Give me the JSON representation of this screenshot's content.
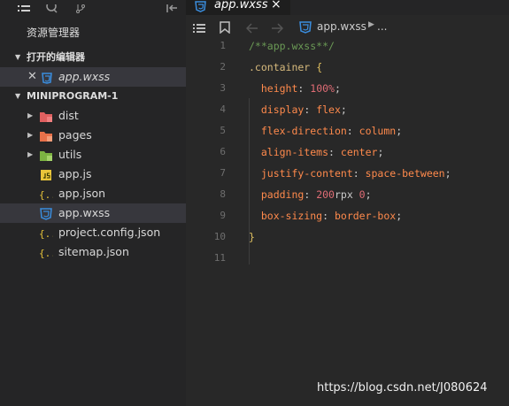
{
  "sidebar": {
    "title": "资源管理器",
    "open_editors": {
      "label": "打开的编辑器",
      "items": [
        {
          "label": "app.wxss"
        }
      ]
    },
    "project": {
      "label": "MINIPROGRAM-1",
      "items": [
        {
          "label": "dist",
          "type": "folder",
          "icon": "folder-red-icon"
        },
        {
          "label": "pages",
          "type": "folder",
          "icon": "folder-orange-icon"
        },
        {
          "label": "utils",
          "type": "folder",
          "icon": "folder-green-icon"
        },
        {
          "label": "app.js",
          "type": "file",
          "icon": "js-file-icon"
        },
        {
          "label": "app.json",
          "type": "file",
          "icon": "json-file-icon"
        },
        {
          "label": "app.wxss",
          "type": "file",
          "icon": "css-file-icon",
          "selected": true
        },
        {
          "label": "project.config.json",
          "type": "file",
          "icon": "json-file-icon"
        },
        {
          "label": "sitemap.json",
          "type": "file",
          "icon": "json-file-icon"
        }
      ]
    }
  },
  "editor": {
    "tab": {
      "label": "app.wxss",
      "close": "×"
    },
    "breadcrumb": {
      "file": "app.wxss",
      "more": "..."
    },
    "lines": [
      {
        "n": "1",
        "tokens": [
          [
            "comment",
            "/**app.wxss**/"
          ]
        ]
      },
      {
        "n": "2",
        "tokens": [
          [
            "sel",
            ".container"
          ],
          [
            "punc",
            " "
          ],
          [
            "brace",
            "{"
          ]
        ]
      },
      {
        "n": "3",
        "tokens": [
          [
            "punc",
            "  "
          ],
          [
            "prop",
            "height"
          ],
          [
            "punc",
            ": "
          ],
          [
            "num",
            "100%"
          ],
          [
            "punc",
            ";"
          ]
        ]
      },
      {
        "n": "4",
        "tokens": [
          [
            "punc",
            "  "
          ],
          [
            "prop",
            "display"
          ],
          [
            "punc",
            ": "
          ],
          [
            "val",
            "flex"
          ],
          [
            "punc",
            ";"
          ]
        ]
      },
      {
        "n": "5",
        "tokens": [
          [
            "punc",
            "  "
          ],
          [
            "prop",
            "flex-direction"
          ],
          [
            "punc",
            ": "
          ],
          [
            "val",
            "column"
          ],
          [
            "punc",
            ";"
          ]
        ]
      },
      {
        "n": "6",
        "tokens": [
          [
            "punc",
            "  "
          ],
          [
            "prop",
            "align-items"
          ],
          [
            "punc",
            ": "
          ],
          [
            "val",
            "center"
          ],
          [
            "punc",
            ";"
          ]
        ]
      },
      {
        "n": "7",
        "tokens": [
          [
            "punc",
            "  "
          ],
          [
            "prop",
            "justify-content"
          ],
          [
            "punc",
            ": "
          ],
          [
            "val",
            "space-between"
          ],
          [
            "punc",
            ";"
          ]
        ]
      },
      {
        "n": "8",
        "tokens": [
          [
            "punc",
            "  "
          ],
          [
            "prop",
            "padding"
          ],
          [
            "punc",
            ": "
          ],
          [
            "num",
            "200"
          ],
          [
            "punc",
            "rpx "
          ],
          [
            "num",
            "0"
          ],
          [
            "punc",
            ";"
          ]
        ]
      },
      {
        "n": "9",
        "tokens": [
          [
            "punc",
            "  "
          ],
          [
            "prop",
            "box-sizing"
          ],
          [
            "punc",
            ": "
          ],
          [
            "val",
            "border-box"
          ],
          [
            "punc",
            ";"
          ]
        ]
      },
      {
        "n": "10",
        "tokens": [
          [
            "brace",
            "}"
          ]
        ]
      },
      {
        "n": "11",
        "tokens": []
      }
    ]
  },
  "watermark": "https://blog.csdn.net/J080624",
  "colors": {
    "background": "#282828",
    "sidebar": "#252526",
    "selected_row": "#37373d",
    "css_icon": "#3a8dde"
  }
}
